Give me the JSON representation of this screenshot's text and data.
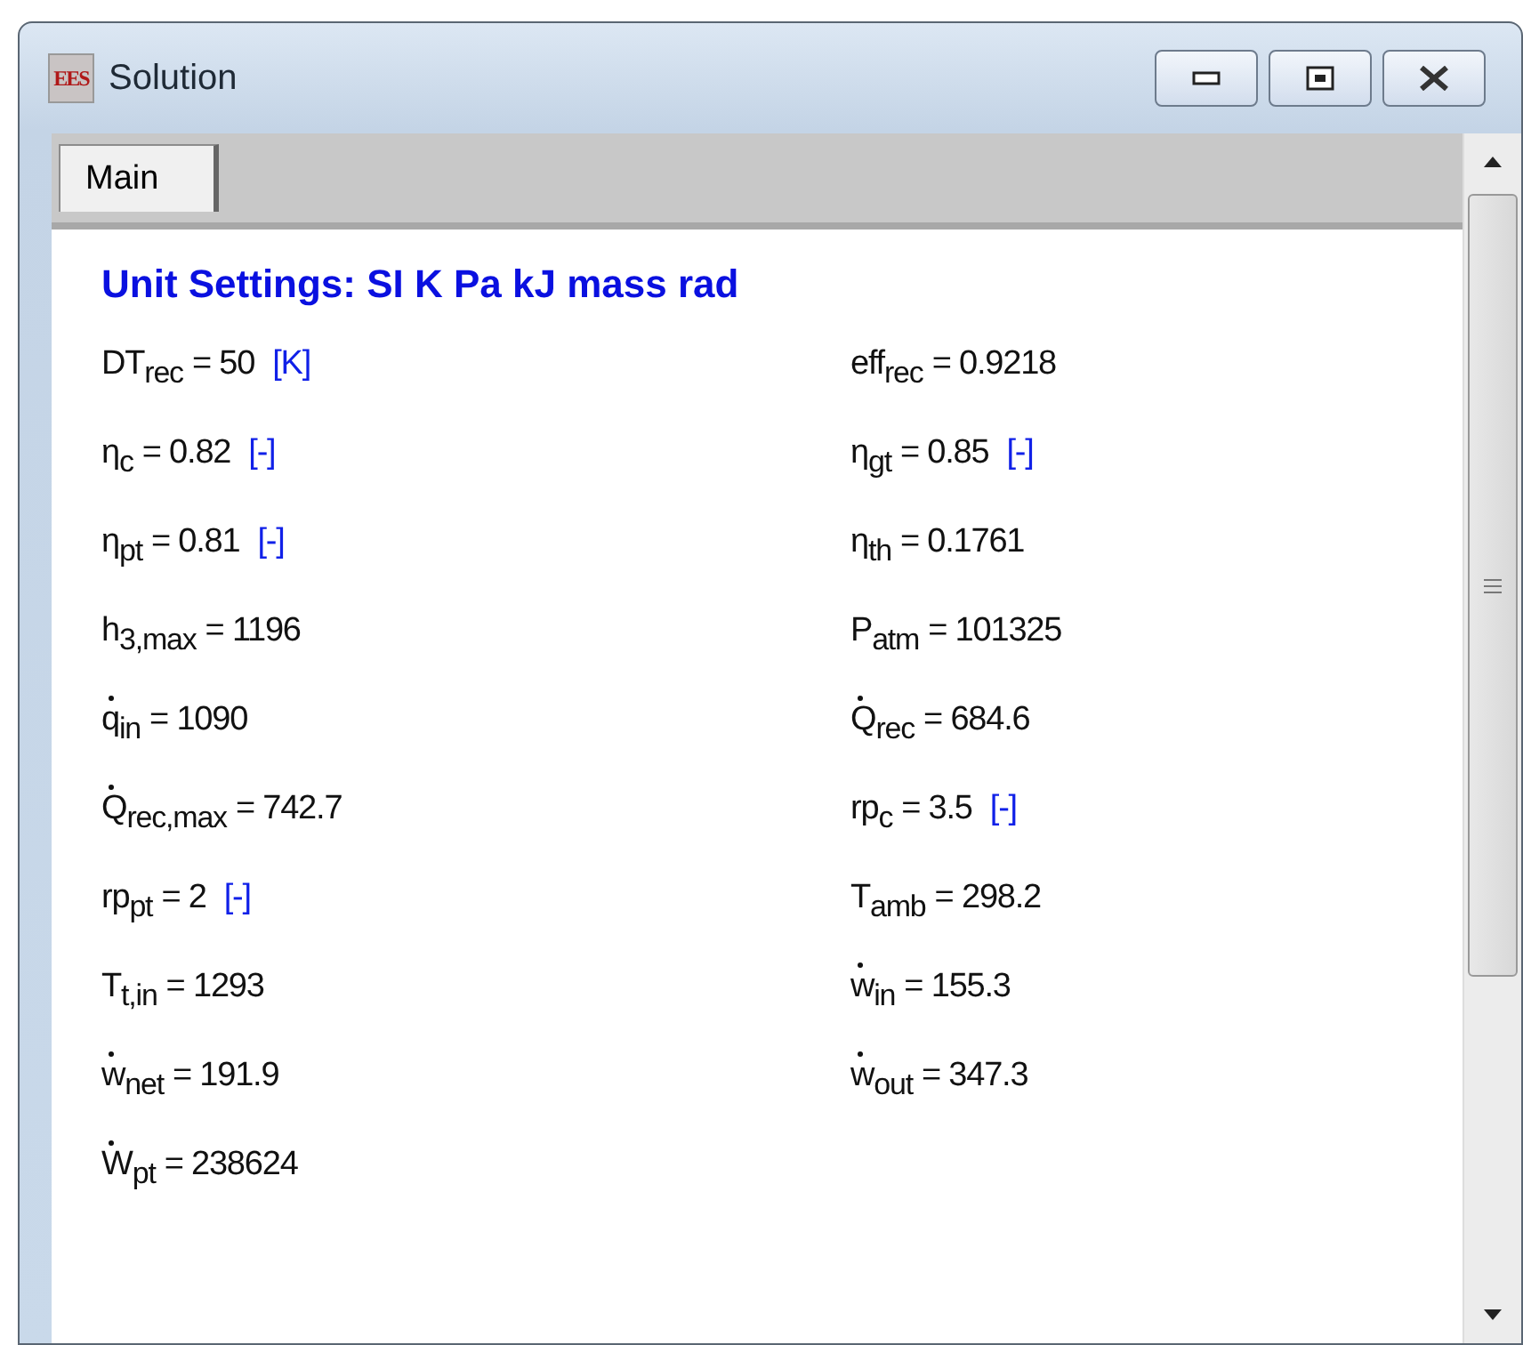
{
  "window": {
    "icon_text": "EES",
    "title": "Solution"
  },
  "tabs": [
    {
      "label": "Main",
      "selected": true
    }
  ],
  "heading": "Unit Settings: SI K Pa kJ mass rad",
  "variables": [
    {
      "base": "DT",
      "sub": "rec",
      "dotted": false,
      "value": "= 50",
      "unit": "[K]"
    },
    {
      "base": "eff",
      "sub": "rec",
      "dotted": false,
      "value": "= 0.9218"
    },
    {
      "base": "η",
      "sub": "c",
      "dotted": false,
      "value": "= 0.82",
      "unit": "[-]"
    },
    {
      "base": "η",
      "sub": "gt",
      "dotted": false,
      "value": "= 0.85",
      "unit": "[-]"
    },
    {
      "base": "η",
      "sub": "pt",
      "dotted": false,
      "value": "= 0.81",
      "unit": "[-]"
    },
    {
      "base": "η",
      "sub": "th",
      "dotted": false,
      "value": "= 0.1761"
    },
    {
      "base": "h",
      "sub": "3,max",
      "dotted": false,
      "value": "= 1196"
    },
    {
      "base": "P",
      "sub": "atm",
      "dotted": false,
      "value": "= 101325"
    },
    {
      "base": "q",
      "sub": "in",
      "dotted": true,
      "value": "= 1090"
    },
    {
      "base": "Q",
      "sub": "rec",
      "dotted": true,
      "value": "= 684.6"
    },
    {
      "base": "Q",
      "sub": "rec,max",
      "dotted": true,
      "value": "= 742.7"
    },
    {
      "base": "rp",
      "sub": "c",
      "dotted": false,
      "value": "= 3.5",
      "unit": "[-]"
    },
    {
      "base": "rp",
      "sub": "pt",
      "dotted": false,
      "value": "= 2",
      "unit": "[-]"
    },
    {
      "base": "T",
      "sub": "amb",
      "dotted": false,
      "value": "= 298.2"
    },
    {
      "base": "T",
      "sub": "t,in",
      "dotted": false,
      "value": "= 1293"
    },
    {
      "base": "w",
      "sub": "in",
      "dotted": true,
      "value": "= 155.3"
    },
    {
      "base": "w",
      "sub": "net",
      "dotted": true,
      "value": "= 191.9"
    },
    {
      "base": "w",
      "sub": "out",
      "dotted": true,
      "value": "= 347.3"
    },
    {
      "base": "W",
      "sub": "pt",
      "dotted": true,
      "value": "= 238624"
    }
  ]
}
